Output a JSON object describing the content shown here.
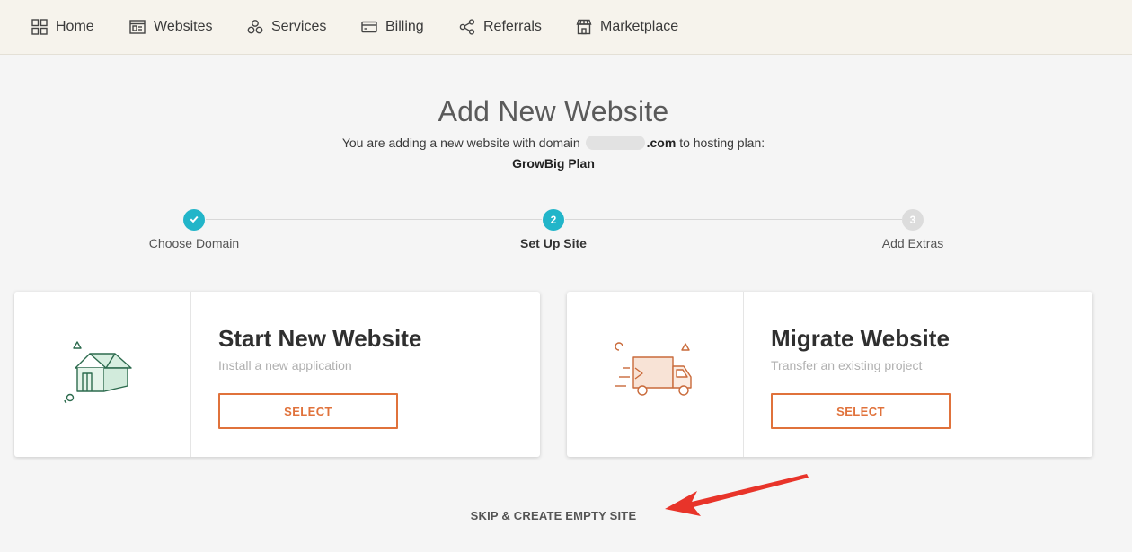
{
  "nav": {
    "items": [
      {
        "label": "Home",
        "icon": "grid-icon"
      },
      {
        "label": "Websites",
        "icon": "websites-icon"
      },
      {
        "label": "Services",
        "icon": "services-icon"
      },
      {
        "label": "Billing",
        "icon": "credit-card-icon"
      },
      {
        "label": "Referrals",
        "icon": "share-icon"
      },
      {
        "label": "Marketplace",
        "icon": "store-icon"
      }
    ]
  },
  "header": {
    "title": "Add New Website",
    "subtitle_before": "You are adding a new website with domain",
    "domain_suffix": ".com",
    "subtitle_after": "to hosting plan:",
    "plan": "GrowBig Plan"
  },
  "stepper": {
    "steps": [
      {
        "label": "Choose Domain",
        "status": "complete",
        "number": ""
      },
      {
        "label": "Set Up Site",
        "status": "active",
        "number": "2"
      },
      {
        "label": "Add Extras",
        "status": "pending",
        "number": "3"
      }
    ],
    "colors": {
      "active": "#22b5c9",
      "pending": "#dcdcdc"
    }
  },
  "cards": [
    {
      "title": "Start New Website",
      "description": "Install a new application",
      "button": "SELECT",
      "icon": "house-icon"
    },
    {
      "title": "Migrate Website",
      "description": "Transfer an existing project",
      "button": "SELECT",
      "icon": "truck-icon"
    }
  ],
  "skip_label": "SKIP & CREATE EMPTY SITE",
  "colors": {
    "accent": "#e0723b",
    "nav_bg": "#f6f3ec",
    "annotation": "#e8342a"
  }
}
